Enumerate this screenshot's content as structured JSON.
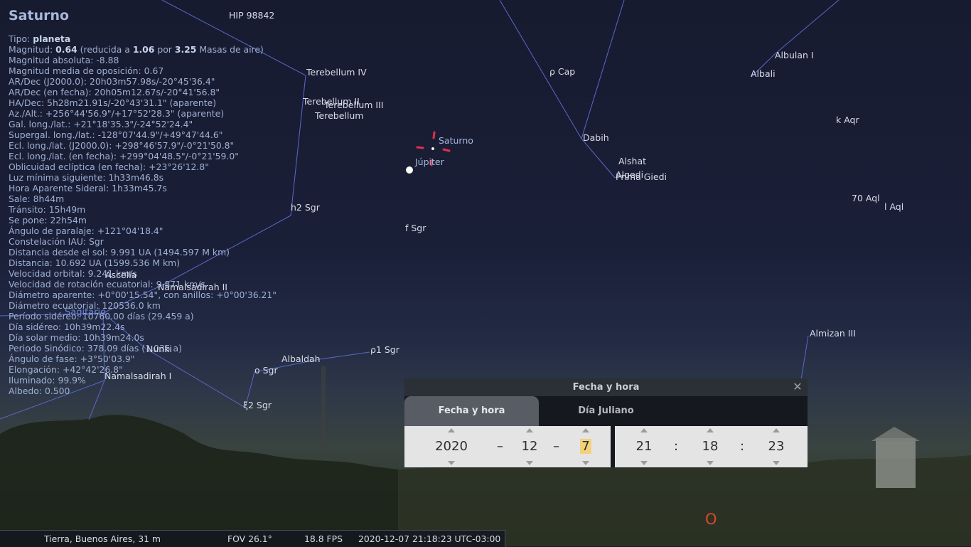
{
  "object": {
    "name": "Saturno",
    "info_lines": [
      {
        "pre": "Tipo: ",
        "b1": "planeta",
        "mid": "",
        "b2": "",
        "mid2": "",
        "b3": "",
        "post": ""
      },
      {
        "pre": "Magnitud: ",
        "b1": "0.64",
        "mid": " (reducida a ",
        "b2": "1.06",
        "mid2": " por ",
        "b3": "3.25",
        "post": " Masas de aire)"
      },
      {
        "pre": "Magnitud absoluta: -8.88"
      },
      {
        "pre": "Magnitud media de oposición: 0.67"
      },
      {
        "pre": "AR/Dec (J2000.0): 20h03m57.98s/-20°45'36.4\""
      },
      {
        "pre": "AR/Dec (en fecha): 20h05m12.67s/-20°41'56.8\""
      },
      {
        "pre": "HA/Dec: 5h28m21.91s/-20°43'31.1\" (aparente)"
      },
      {
        "pre": "Az./Alt.: +256°44'56.9\"/+17°52'28.3\" (aparente)"
      },
      {
        "pre": "Gal. long./lat.: +21°18'35.3\"/-24°52'24.4\""
      },
      {
        "pre": "Supergal. long./lat.: -128°07'44.9\"/+49°47'44.6\""
      },
      {
        "pre": "Ecl. long./lat. (J2000.0): +298°46'57.9\"/-0°21'50.8\""
      },
      {
        "pre": "Ecl. long./lat. (en fecha): +299°04'48.5\"/-0°21'59.0\""
      },
      {
        "pre": "Oblicuidad eclíptica (en fecha): +23°26'12.8\""
      },
      {
        "pre": "Luz mínima siguiente: 1h33m46.8s"
      },
      {
        "pre": "Hora Aparente Sideral: 1h33m45.7s"
      },
      {
        "pre": "Sale: 8h44m"
      },
      {
        "pre": "Tránsito: 15h49m"
      },
      {
        "pre": "Se pone: 22h54m"
      },
      {
        "pre": "Ángulo de paralaje: +121°04'18.4\""
      },
      {
        "pre": "Constelación IAU: Sgr"
      },
      {
        "pre": "Distancia desde el sol: 9.991 UA (1494.597 M km)"
      },
      {
        "pre": "Distancia: 10.692 UA (1599.536 M km)"
      },
      {
        "pre": "Velocidad orbital: 9.241 km/s"
      },
      {
        "pre": "Velocidad de rotación ecuatorial: 9.871 km/s"
      },
      {
        "pre": "Diámetro aparente: +0°00'15.54\", con anillos: +0°00'36.21\""
      },
      {
        "pre": "Diámetro ecuatorial: 120536.0 km"
      },
      {
        "pre": "Período sidéreo: 10760.00 días (29.459 a)"
      },
      {
        "pre": "Día sidéreo: 10h39m22.4s"
      },
      {
        "pre": "Día solar medio: 10h39m24.0s"
      },
      {
        "pre": "Periodo Sinódico: 378.09 días (1.035 a)"
      },
      {
        "pre": "Ángulo de fase: +3°50'03.9\""
      },
      {
        "pre": "Elongación: +42°42'26.8\""
      },
      {
        "pre": "Iluminado: 99.9%"
      },
      {
        "pre": "Albedo: 0.500"
      }
    ]
  },
  "sky": {
    "stars": [
      "HIP 98842",
      "Terebellum IV",
      "Terebellum II",
      "Terebellum III",
      "Terebellum",
      "ρ Cap",
      "Dabih",
      "Alshat",
      "Algedi",
      "Prima Giedi",
      "Albulan I",
      "Albali",
      "k Aqr",
      "70 Aql",
      "l Aql",
      "h2 Sgr",
      "f Sgr",
      "Ascella",
      "Namalsadirah II",
      "Nunki",
      "Albaldah",
      "ρ1 Sgr",
      "o Sgr",
      "ξ2 Sgr",
      "Namalsadirah I",
      "Almizan III"
    ],
    "planets": [
      "Saturno",
      "Júpiter"
    ],
    "constellation": "Sagitario",
    "compass": "O",
    "colors": {
      "sky": "#1a1f38",
      "constellation_lines": "#5a68c8",
      "marker": "#e0304a"
    }
  },
  "dialog": {
    "title": "Fecha y hora",
    "close_icon": "close-icon",
    "tabs": [
      "Fecha y hora",
      "Día Juliano"
    ],
    "date": {
      "year": "2020",
      "month": "12",
      "day": "7",
      "sep": "–"
    },
    "time": {
      "hour": "21",
      "minute": "18",
      "second": "23",
      "sep": ":"
    }
  },
  "statusbar": {
    "location": "Tierra, Buenos Aires, 31 m",
    "fov": "FOV 26.1°",
    "fps": "18.8 FPS",
    "datetime": "2020-12-07 21:18:23 UTC-03:00"
  }
}
